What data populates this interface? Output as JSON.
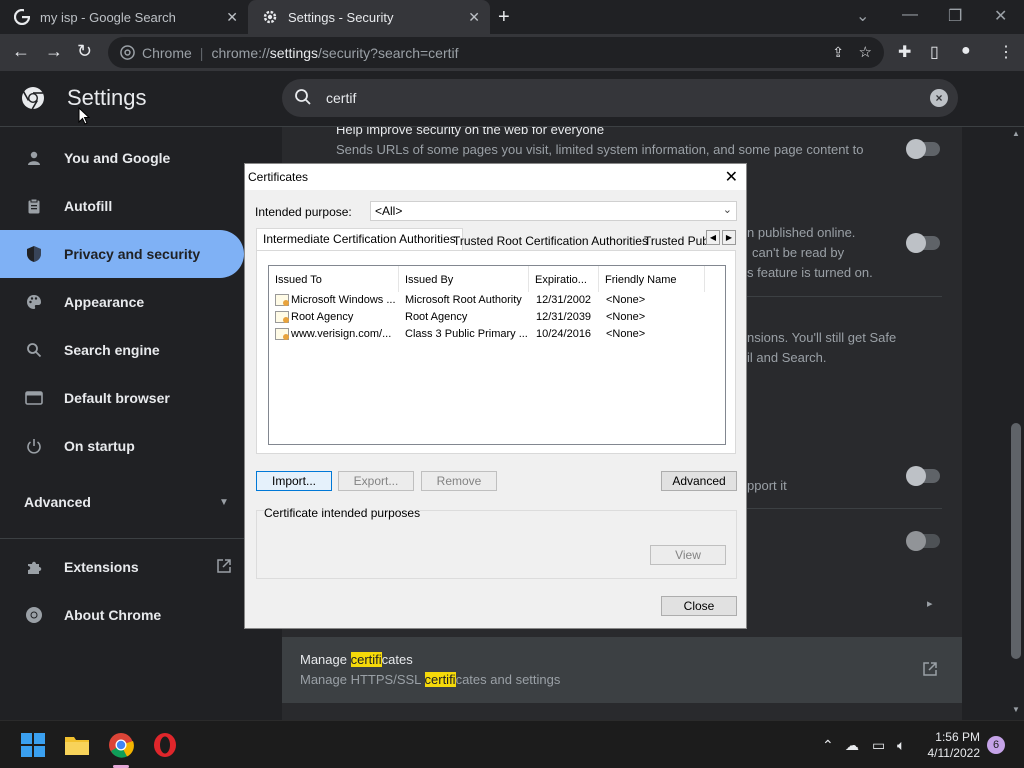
{
  "browser": {
    "tabs": [
      {
        "title": "my isp - Google Search",
        "active": false
      },
      {
        "title": "Settings - Security",
        "active": true
      }
    ],
    "new_tab": "+",
    "omnibox": {
      "site_label": "Chrome",
      "url_prefix": "chrome://",
      "url_host": "settings",
      "url_suffix": "/security?search=certif"
    }
  },
  "settings": {
    "title": "Settings",
    "search_value": "certif",
    "sidebar": {
      "items": [
        {
          "label": "You and Google",
          "icon": "person-icon"
        },
        {
          "label": "Autofill",
          "icon": "clipboard-icon"
        },
        {
          "label": "Privacy and security",
          "icon": "shield-icon",
          "selected": true
        },
        {
          "label": "Appearance",
          "icon": "palette-icon"
        },
        {
          "label": "Search engine",
          "icon": "search-icon"
        },
        {
          "label": "Default browser",
          "icon": "browser-icon"
        },
        {
          "label": "On startup",
          "icon": "power-icon"
        }
      ],
      "advanced": "Advanced",
      "extensions": "Extensions",
      "about": "About Chrome"
    },
    "main": {
      "row1_title": "Help improve security on the web for everyone",
      "row1_desc": "Sends URLs of some pages you visit, limited system information, and some page content to",
      "row2_desc_a": "n published online.",
      "row2_desc_b": "can't be read by",
      "row2_desc_c": "s feature is turned on.",
      "row3_desc_a": "nsions. You'll still get Safe",
      "row3_desc_b": "il and Search.",
      "row4_desc": "pport it",
      "manage": {
        "title_pre": "Manage ",
        "title_hl": "certifi",
        "title_post": "cates",
        "desc_pre": "Manage HTTPS/SSL ",
        "desc_hl": "certifi",
        "desc_post": "cates and settings"
      }
    }
  },
  "dialog": {
    "title": "Certificates",
    "intended_purpose_label": "Intended purpose:",
    "intended_purpose_value": "<All>",
    "tabs": [
      "Intermediate Certification Authorities",
      "Trusted Root Certification Authorities",
      "Trusted Publ"
    ],
    "columns": [
      "Issued To",
      "Issued By",
      "Expiratio...",
      "Friendly Name"
    ],
    "rows": [
      {
        "issued_to": "Microsoft Windows ...",
        "issued_by": "Microsoft Root Authority",
        "expiration": "12/31/2002",
        "friendly": "<None>"
      },
      {
        "issued_to": "Root Agency",
        "issued_by": "Root Agency",
        "expiration": "12/31/2039",
        "friendly": "<None>"
      },
      {
        "issued_to": "www.verisign.com/...",
        "issued_by": "Class 3 Public Primary ...",
        "expiration": "10/24/2016",
        "friendly": "<None>"
      }
    ],
    "buttons": {
      "import": "Import...",
      "export": "Export...",
      "remove": "Remove",
      "advanced": "Advanced",
      "view": "View",
      "close": "Close"
    },
    "purposes_label": "Certificate intended purposes"
  },
  "taskbar": {
    "time": "1:56 PM",
    "date": "4/11/2022",
    "notifications": "6"
  },
  "colors": {
    "accent": "#8ab4f8",
    "highlight": "#f5d90a",
    "dialog_bg": "#f0f0f0"
  }
}
